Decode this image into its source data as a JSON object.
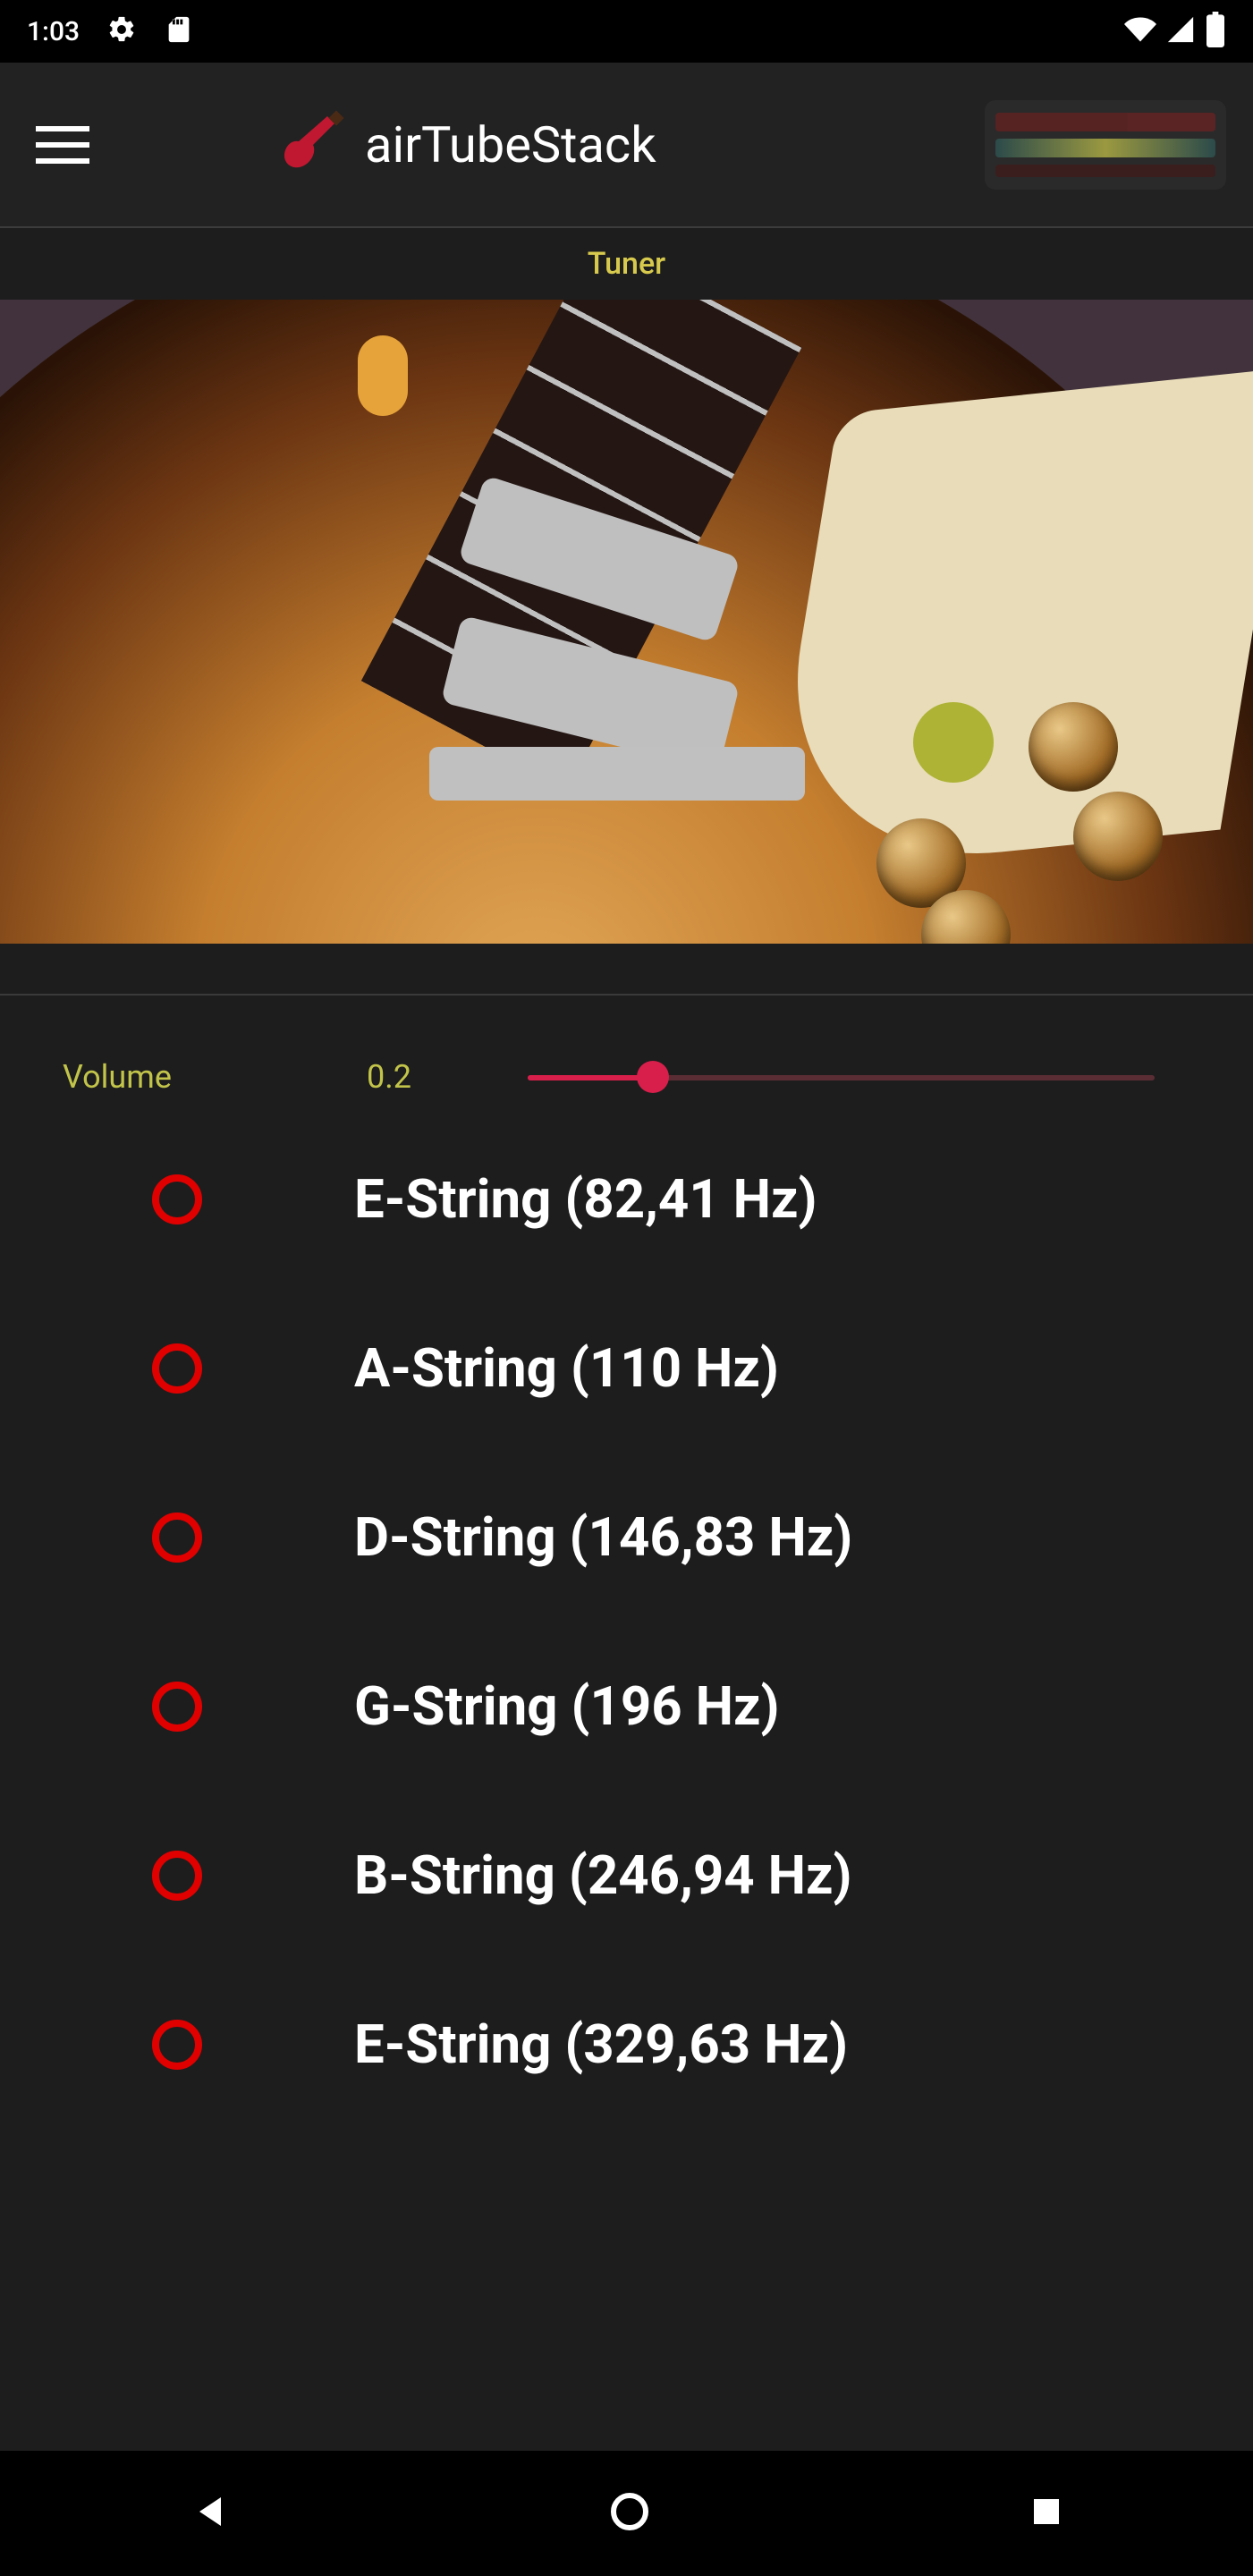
{
  "status": {
    "time": "1:03"
  },
  "appbar": {
    "title": "airTubeStack"
  },
  "subheader": {
    "text": "Tuner"
  },
  "volume": {
    "label": "Volume",
    "value": "0.2",
    "percent": 20
  },
  "strings": [
    {
      "label": "E-String (82,41 Hz)"
    },
    {
      "label": "A-String (110 Hz)"
    },
    {
      "label": "D-String (146,83 Hz)"
    },
    {
      "label": "G-String (196 Hz)"
    },
    {
      "label": "B-String (246,94 Hz)"
    },
    {
      "label": "E-String (329,63 Hz)"
    }
  ]
}
